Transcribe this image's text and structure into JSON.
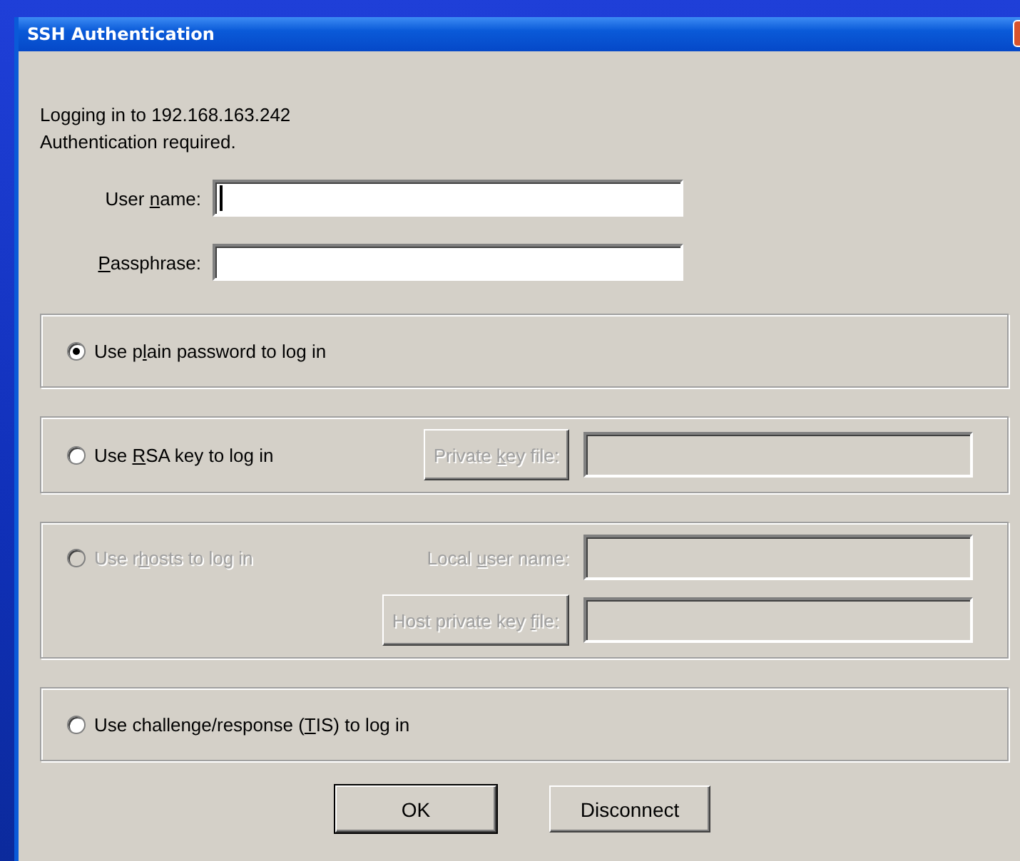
{
  "window": {
    "title": "SSH Authentication"
  },
  "messages": [
    "Logging in to 192.168.163.242",
    "Authentication required."
  ],
  "fields": [
    {
      "label": {
        "pre": "User ",
        "key": "n",
        "post": "ame:"
      },
      "focused": true
    },
    {
      "label": {
        "key": "P",
        "post": "assphrase:"
      },
      "focused": false
    }
  ],
  "groups": [
    {
      "radio": {
        "label": {
          "pre": "Use p",
          "key": "l",
          "post": "ain password to log in"
        },
        "selected": true,
        "disabled": false
      }
    },
    {
      "radio": {
        "label": {
          "pre": "Use ",
          "key": "R",
          "post": "SA key to log in"
        },
        "selected": false,
        "disabled": false
      },
      "rows": [
        [
          {
            "kind": "button",
            "label": {
              "pre": "Private ",
              "key": "k",
              "post": "ey file:"
            },
            "disabled": true
          },
          {
            "kind": "field",
            "disabled": true
          }
        ]
      ]
    },
    {
      "radio": {
        "label": {
          "pre": "Use r",
          "key": "h",
          "post": "osts to log in"
        },
        "selected": false,
        "disabled": true
      },
      "rows": [
        [
          {
            "kind": "label",
            "label": {
              "pre": "Local ",
              "key": "u",
              "post": "ser name:"
            },
            "disabled": true
          },
          {
            "kind": "field",
            "disabled": true
          }
        ],
        [
          {
            "kind": "button",
            "label": {
              "pre": "Host private key ",
              "key": "f",
              "post": "ile:"
            },
            "disabled": true
          },
          {
            "kind": "field",
            "disabled": true
          }
        ]
      ]
    },
    {
      "radio": {
        "label": {
          "pre": "Use challenge/response (",
          "key": "T",
          "post": "IS) to log in"
        },
        "selected": false,
        "disabled": false
      }
    }
  ],
  "buttons": [
    {
      "label": "OK",
      "default": true
    },
    {
      "label": "Disconnect",
      "default": false
    }
  ]
}
